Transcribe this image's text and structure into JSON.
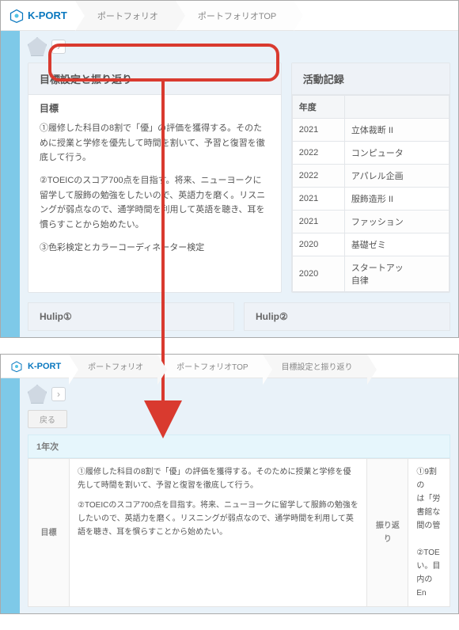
{
  "top": {
    "logo_text": "K-PORT",
    "breadcrumbs": [
      "ポートフォリオ",
      "ポートフォリオTOP"
    ],
    "goal_card": {
      "title": "目標設定と振り返り",
      "sub": "目標",
      "p1": "①履修した科目の8割で「優」の評価を獲得する。そのために授業と学修を優先して時間を割いて、予習と復習を徹底して行う。",
      "p2": "②TOEICのスコア700点を目指す。将来、ニューヨークに留学して服飾の勉強をしたいので、英語力を磨く。リスニングが弱点なので、通学時間を利用して英語を聴き、耳を慣らすことから始めたい。",
      "p3": "③色彩検定とカラーコーディネーター検定"
    },
    "activity": {
      "title": "活動記録",
      "col_year": "年度",
      "rows": [
        {
          "y": "2021",
          "t": "立体裁断 II"
        },
        {
          "y": "2022",
          "t": "コンピュータ"
        },
        {
          "y": "2022",
          "t": "アパレル企画"
        },
        {
          "y": "2021",
          "t": "服飾造形 II"
        },
        {
          "y": "2021",
          "t": "ファッション"
        },
        {
          "y": "2020",
          "t": "基礎ゼミ"
        },
        {
          "y": "2020",
          "t": "スタートアッ\n自律"
        }
      ]
    },
    "hulip1": "Hulip①",
    "hulip2": "Hulip②"
  },
  "bottom": {
    "logo_text": "K-PORT",
    "breadcrumbs": [
      "ポートフォリオ",
      "ポートフォリオTOP",
      "目標設定と振り返り"
    ],
    "back": "戻る",
    "year": "1年次",
    "goal_label": "目標",
    "goal_p1": "①履修した科目の8割で「優」の評価を獲得する。そのために授業と学修を優先して時間を割いて、予習と復習を徹底して行う。",
    "goal_p2": "②TOEICのスコア700点を目指す。将来、ニューヨークに留学して服飾の勉強をしたいので、英語力を磨く。リスニングが弱点なので、通学時間を利用して英語を聴き、耳を慣らすことから始めたい。",
    "refl_label": "振り返り",
    "refl_p1": "①9割の\nは「労\n書館な\n間の管\n\n②TOE\nい。目\n内のEn"
  }
}
